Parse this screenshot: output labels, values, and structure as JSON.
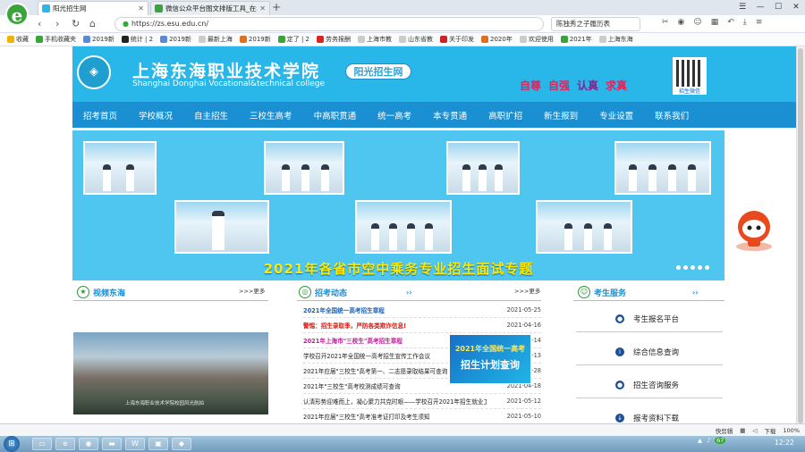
{
  "browser": {
    "tabs": [
      {
        "label": "阳光招生网",
        "active": true
      },
      {
        "label": "微信公众平台图文排版工具_在线",
        "active": false
      }
    ],
    "url": "https://zs.esu.edu.cn/",
    "search_text": "陈独秀之子履历表",
    "bookmarks": [
      "收藏",
      "手机收藏夹",
      "2019新",
      "统计 | 2",
      "2019新",
      "最新上海",
      "2019新",
      "定了 | 2",
      "劳务报酬",
      "上海市教",
      "山东省教",
      "关于印发",
      "2020年",
      "欢迎使用",
      "2021年",
      "上海东海"
    ],
    "status": {
      "quick_edit": "快剪辑",
      "download": "下载",
      "zoom": "100%"
    },
    "taskbar_clock": "12:22",
    "tray_badge": "67"
  },
  "site": {
    "school_name_cn": "上海东海职业技术学院",
    "school_name_en": "Shanghai Donghai Vocational&technical college",
    "portal_badge": "阳光招生网",
    "motto": [
      "自尊",
      "自强",
      "认真",
      "求真"
    ],
    "motto_colors": [
      "#e0245e",
      "#e0245e",
      "#7a2b8f",
      "#e0245e"
    ],
    "qr_label": "招生微信",
    "nav": [
      "招考首页",
      "学校概况",
      "自主招生",
      "三校生高考",
      "中高职贯通",
      "统一高考",
      "本专贯通",
      "高职扩招",
      "新生报到",
      "专业设置",
      "联系我们"
    ],
    "banner_title": "2021年各省市空中乘务专业招生面试专题",
    "video_section": {
      "title": "视频东海",
      "more": ">>>更多",
      "caption": "上海东海职业技术学院校园风光航拍"
    },
    "news_section": {
      "title": "招考动态",
      "more": ">>>更多",
      "items": [
        {
          "title": "2021年全国统一高考招生章程",
          "date": "2021-05-25",
          "color": "#1a5fb4",
          "bold": true
        },
        {
          "title": "警惕：招生录取季，严防各类欺诈信息!",
          "date": "2021-04-16",
          "color": "#d8180f",
          "bold": true
        },
        {
          "title": "2021年上海市\"三校生\"高考招生章程",
          "date": "2021-04-14",
          "color": "#c2189e",
          "bold": true
        },
        {
          "title": "学校召开2021年全国统一高考招生宣传工作会议",
          "date": "2021-04-13",
          "color": "#222",
          "bold": false
        },
        {
          "title": "2021年应届\"三校生\"高考第一、二志愿录取结果可查询",
          "date": "2021-04-28",
          "color": "#222",
          "bold": false
        },
        {
          "title": "2021年\"三校生\"高考校测成绩可查询",
          "date": "2021-04-18",
          "color": "#222",
          "bold": false
        },
        {
          "title": "认清形势迎难而上，凝心聚力共克时艰——学校召开2021年招生就业工作会议",
          "date": "2021-05-12",
          "color": "#222",
          "bold": false
        },
        {
          "title": "2021年应届\"三校生\"高考准考证打印及考生须知",
          "date": "2021-05-10",
          "color": "#222",
          "bold": false
        }
      ]
    },
    "popup": {
      "line1": "2021年全国统一高考",
      "line2": "招生计划查询"
    },
    "service_section": {
      "title": "考生服务",
      "items": [
        "考生报名平台",
        "综合信息查询",
        "招生咨询服务",
        "报考资料下载"
      ]
    }
  }
}
